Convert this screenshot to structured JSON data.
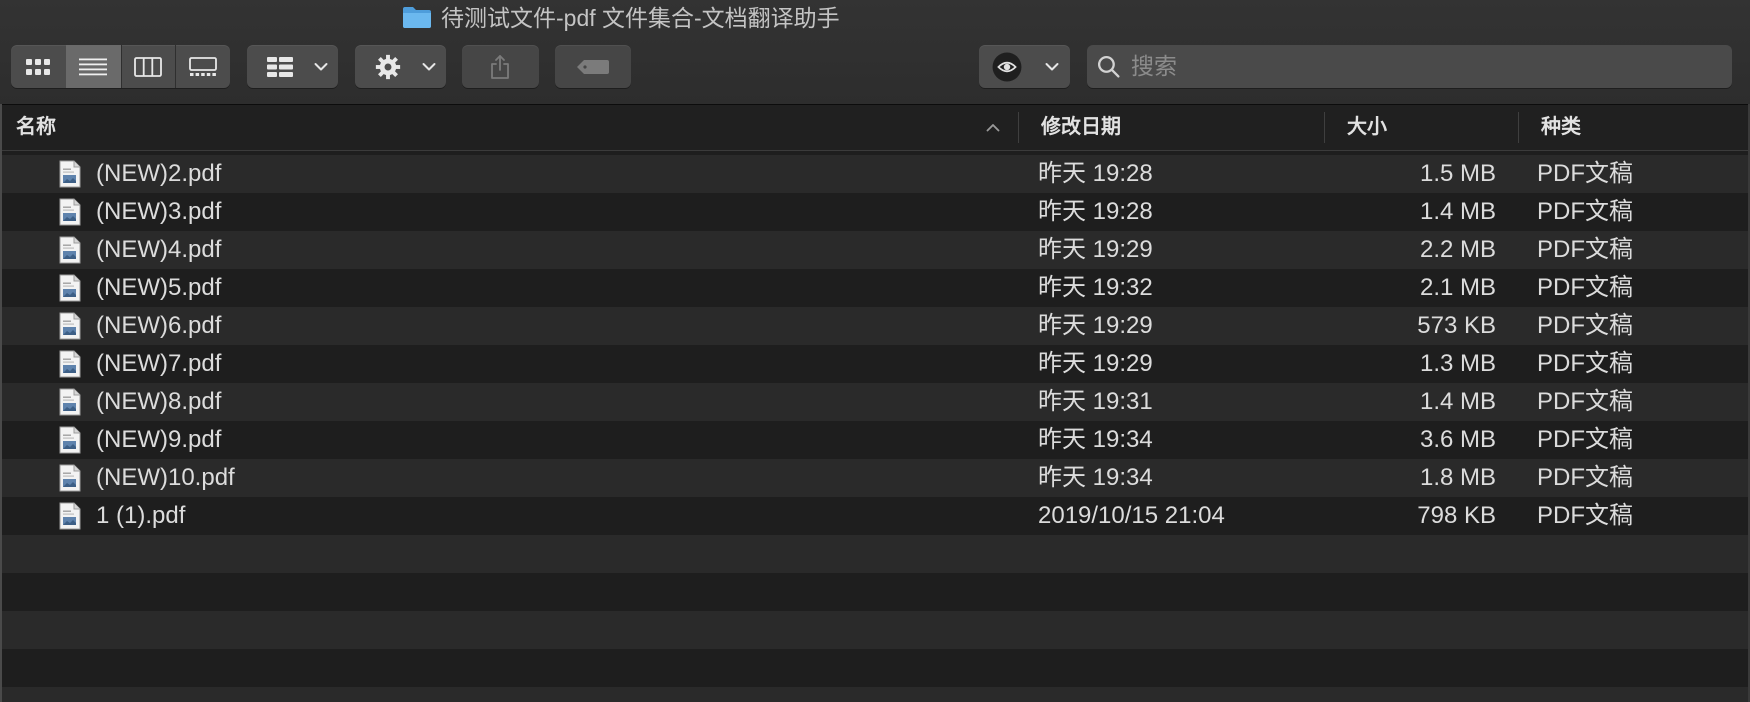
{
  "window": {
    "title": "待测试文件-pdf 文件集合-文档翻译助手",
    "folder_icon": "folder-icon"
  },
  "toolbar": {
    "view_modes": [
      {
        "icon": "icon-view-icon"
      },
      {
        "icon": "list-view-icon"
      },
      {
        "icon": "column-view-icon"
      },
      {
        "icon": "gallery-view-icon"
      }
    ],
    "selected_view": 1,
    "group_icon": "group-icon",
    "action_icon": "gear-icon",
    "share_icon": "share-icon",
    "tag_icon": "tag-icon",
    "quicklook_icon": "eye-icon",
    "search": {
      "placeholder": "搜索",
      "value": "",
      "icon": "search-icon"
    }
  },
  "columns": [
    {
      "label": "名称"
    },
    {
      "label": "修改日期"
    },
    {
      "label": "大小"
    },
    {
      "label": "种类"
    }
  ],
  "sort": {
    "column_index": 0,
    "icon": "chevron-up-icon"
  },
  "files": [
    {
      "name": "(NEW)2.pdf",
      "modified": "昨天 19:28",
      "size": "1.5 MB",
      "kind": "PDF文稿",
      "icon": "pdf-document-icon"
    },
    {
      "name": "(NEW)3.pdf",
      "modified": "昨天 19:28",
      "size": "1.4 MB",
      "kind": "PDF文稿",
      "icon": "pdf-document-icon"
    },
    {
      "name": "(NEW)4.pdf",
      "modified": "昨天 19:29",
      "size": "2.2 MB",
      "kind": "PDF文稿",
      "icon": "pdf-document-icon"
    },
    {
      "name": "(NEW)5.pdf",
      "modified": "昨天 19:32",
      "size": "2.1 MB",
      "kind": "PDF文稿",
      "icon": "pdf-document-icon"
    },
    {
      "name": "(NEW)6.pdf",
      "modified": "昨天 19:29",
      "size": "573 KB",
      "kind": "PDF文稿",
      "icon": "pdf-document-icon"
    },
    {
      "name": "(NEW)7.pdf",
      "modified": "昨天 19:29",
      "size": "1.3 MB",
      "kind": "PDF文稿",
      "icon": "pdf-document-icon"
    },
    {
      "name": "(NEW)8.pdf",
      "modified": "昨天 19:31",
      "size": "1.4 MB",
      "kind": "PDF文稿",
      "icon": "pdf-document-icon"
    },
    {
      "name": "(NEW)9.pdf",
      "modified": "昨天 19:34",
      "size": "3.6 MB",
      "kind": "PDF文稿",
      "icon": "pdf-document-icon"
    },
    {
      "name": "(NEW)10.pdf",
      "modified": "昨天 19:34",
      "size": "1.8 MB",
      "kind": "PDF文稿",
      "icon": "pdf-document-icon"
    },
    {
      "name": "1 (1).pdf",
      "modified": "2019/10/15 21:04",
      "size": "798 KB",
      "kind": "PDF文稿",
      "icon": "pdf-document-icon"
    }
  ],
  "colors": {
    "folder": "#5aa9e6",
    "row_light": "#2a2a2a",
    "row_dark": "#1e1e1e",
    "toolbar_button": "#4c4c4c",
    "selected_segment": "#6a6a6a"
  }
}
